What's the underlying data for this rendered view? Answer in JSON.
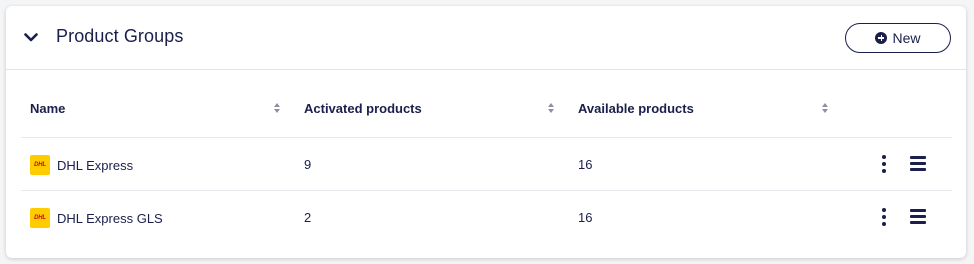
{
  "header": {
    "title": "Product Groups",
    "new_button_label": "New",
    "collapse_icon": "chevron-down-icon",
    "new_icon": "plus-circle-icon"
  },
  "table": {
    "columns": [
      "Name",
      "Activated products",
      "Available products"
    ],
    "rows": [
      {
        "name": "DHL Express",
        "logo_text": "DHL",
        "activated": "9",
        "available": "16"
      },
      {
        "name": "DHL Express GLS",
        "logo_text": "DHL",
        "activated": "2",
        "available": "16"
      }
    ]
  },
  "colors": {
    "text": "#1a1f4b",
    "dhl_yellow": "#ffcc00",
    "dhl_red": "#d40511",
    "border": "#e1e3ea"
  }
}
